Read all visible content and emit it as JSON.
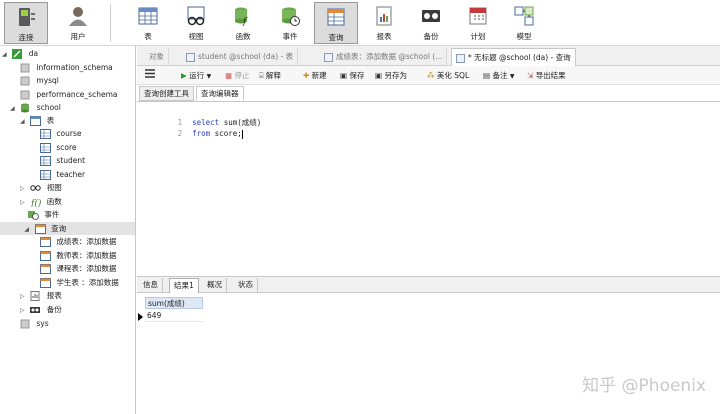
{
  "toolbar": {
    "items": [
      {
        "label": "连接",
        "icon": "connection-icon"
      },
      {
        "label": "用户",
        "icon": "user-icon"
      },
      {
        "label": "表",
        "icon": "table-icon"
      },
      {
        "label": "视图",
        "icon": "view-icon"
      },
      {
        "label": "函数",
        "icon": "function-icon"
      },
      {
        "label": "事件",
        "icon": "event-icon"
      },
      {
        "label": "查询",
        "icon": "query-icon"
      },
      {
        "label": "报表",
        "icon": "report-icon"
      },
      {
        "label": "备份",
        "icon": "backup-icon"
      },
      {
        "label": "计划",
        "icon": "schedule-icon"
      },
      {
        "label": "模型",
        "icon": "model-icon"
      }
    ]
  },
  "tree": {
    "connection": "da",
    "databases": [
      "information_schema",
      "mysql",
      "performance_schema"
    ],
    "school": {
      "name": "school",
      "tables_label": "表",
      "tables": [
        "course",
        "score",
        "student",
        "teacher"
      ],
      "views_label": "视图",
      "functions_label": "函数",
      "events_label": "事件",
      "queries_label": "查询",
      "queries": [
        "成绩表：添加数据",
        "教师表：添加数据",
        "课程表：添加数据",
        "学生表 ：添加数据"
      ],
      "reports_label": "报表",
      "backups_label": "备份"
    },
    "sys": "sys"
  },
  "doc_tabs": {
    "objects": "对象",
    "student": "student @school (da) - 表",
    "score_query": "成绩表：添加数据 @school (...",
    "untitled": "* 无标题 @school (da) - 查询"
  },
  "query_toolbar": {
    "run": "运行",
    "stop": "停止",
    "explain": "解释",
    "new": "新建",
    "save": "保存",
    "save_as": "另存为",
    "beautify": "美化 SQL",
    "comment": "备注",
    "export": "导出结果"
  },
  "sub_tabs": {
    "builder": "查询创建工具",
    "editor": "查询编辑器"
  },
  "editor": {
    "lines": [
      {
        "no": "1",
        "kw": "select",
        "rest": " sum(成绩)"
      },
      {
        "no": "2",
        "kw": "from",
        "rest": " score;"
      }
    ]
  },
  "result_tabs": {
    "info": "信息",
    "result1": "结果1",
    "profile": "概况",
    "status": "状态"
  },
  "result": {
    "column": "sum(成绩)",
    "value": "649"
  },
  "watermark": "知乎 @Phoenix"
}
